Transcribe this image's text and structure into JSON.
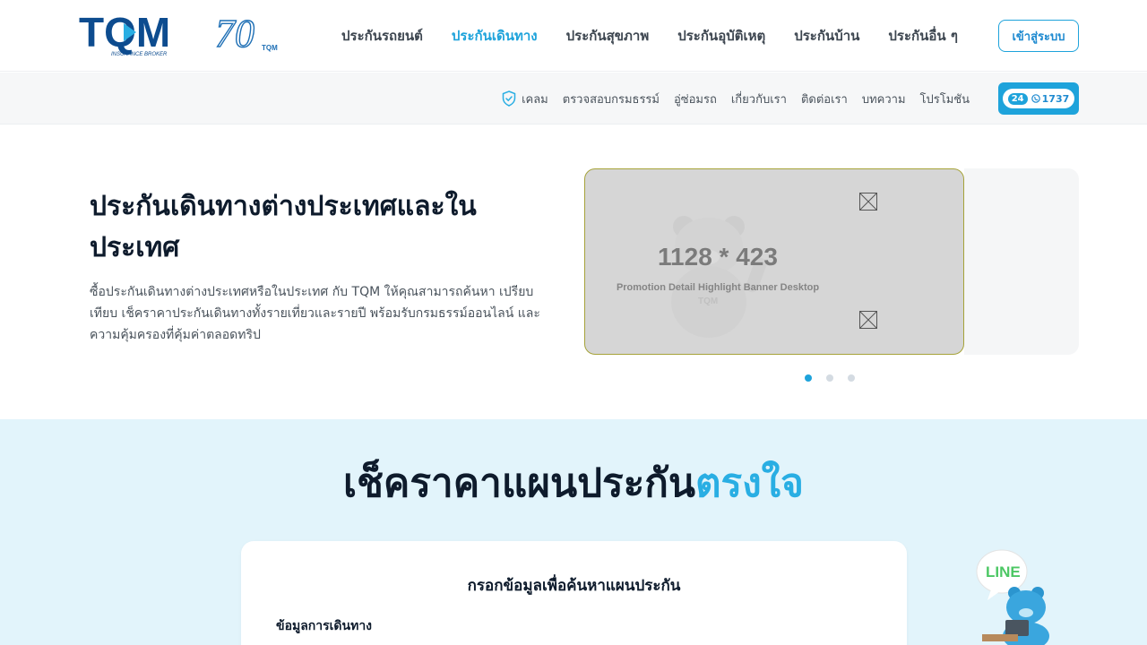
{
  "brand": {
    "logo_text": "TQM",
    "logo_tagline": "INSURANCE BROKER",
    "anniversary_text": "70",
    "anniversary_mark": "TQM"
  },
  "main_nav": {
    "items": [
      {
        "label": "ประกันรถยนต์",
        "active": false
      },
      {
        "label": "ประกันเดินทาง",
        "active": true
      },
      {
        "label": "ประกันสุขภาพ",
        "active": false
      },
      {
        "label": "ประกันอุบัติเหตุ",
        "active": false
      },
      {
        "label": "ประกันบ้าน",
        "active": false
      },
      {
        "label": "ประกันอื่น ๆ",
        "active": false
      }
    ],
    "login_label": "เข้าสู่ระบบ"
  },
  "sub_nav": {
    "items": [
      {
        "label": "เคลม",
        "icon": "shield-check-icon"
      },
      {
        "label": "ตรวจสอบกรมธรรม์"
      },
      {
        "label": "อู่ซ่อมรถ"
      },
      {
        "label": "เกี่ยวกับเรา"
      },
      {
        "label": "ติดต่อเรา"
      },
      {
        "label": "บทความ"
      },
      {
        "label": "โปรโมชัน"
      }
    ],
    "hotline": {
      "badge": "24",
      "number": "1737"
    }
  },
  "hero": {
    "title": "ประกันเดินทางต่างประเทศและในประเทศ",
    "description": "ซื้อประกันเดินทางต่างประเทศหรือในประเทศ กับ TQM ให้คุณสามารถค้นหา เปรียบเทียบ เช็คราคาประกันเดินทางทั้งรายเที่ยวและรายปี พร้อมรับกรมธรรม์ออนไลน์ และความคุ้มครองที่คุ้มค่าตลอดทริป",
    "banner": {
      "size_label": "1128 * 423",
      "caption": "Promotion Detail Highlight Banner Desktop",
      "watermark": "TQM"
    },
    "carousel": {
      "slide_count": 3,
      "active_index": 0
    }
  },
  "plan_section": {
    "title_main": "เช็คราคาแผนประกัน",
    "title_accent": "ตรงใจ",
    "card_title": "กรอกข้อมูลเพื่อค้นหาแผนประกัน",
    "card_subtitle": "ข้อมูลการเดินทาง"
  },
  "line_widget": {
    "label": "LINE"
  },
  "colors": {
    "accent": "#1ea3db",
    "accent_light": "#29aee3",
    "section_bg": "#e2f4fb",
    "text_dark": "#0e1b2c",
    "line_green": "#4cc764"
  }
}
